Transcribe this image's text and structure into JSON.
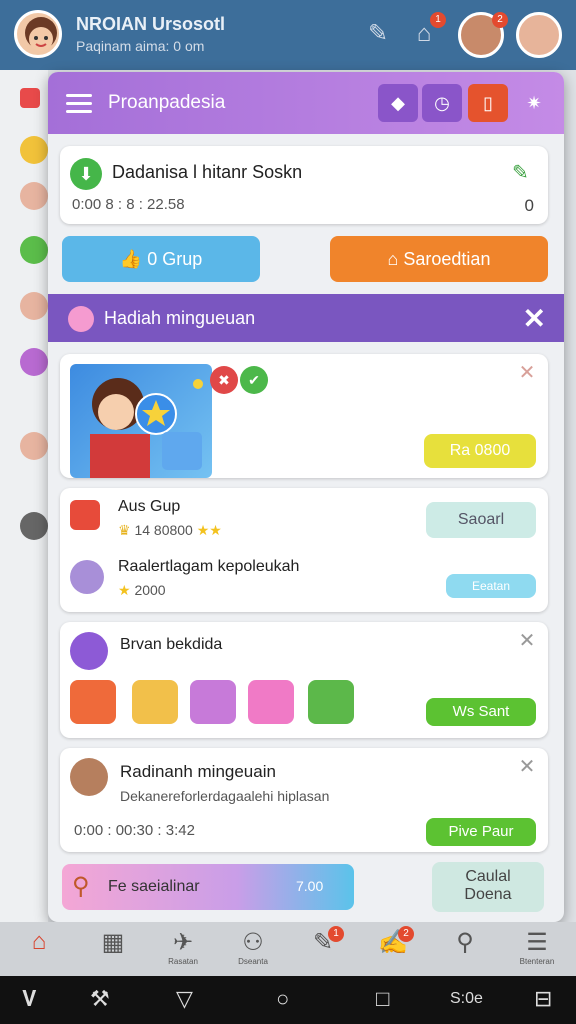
{
  "app_header": {
    "title": "NROIAN Ursosotl",
    "subtitle": "Paqinam aima: 0 om",
    "badges": [
      "1",
      "2"
    ]
  },
  "modal": {
    "title": "Proanpadesia",
    "download_card": {
      "title": "Dadanisa l hitanr Soskn",
      "meta": "0:00 8 : 8 : 22.58",
      "count": "0"
    },
    "buttons": {
      "group": "0 Grup",
      "store": "Saroedtian"
    },
    "section": {
      "title": "Hadiah mingueuan"
    },
    "reward_card": {
      "price": "Ra 0800"
    },
    "task_card": {
      "item1_title": "Aus Gup",
      "item1_meta": "14 80800",
      "item1_button": "Saoarl",
      "item2_title": "Raalertlagam kepoleukah",
      "item2_meta": "2000",
      "item2_button": "Eeatan"
    },
    "gift_card": {
      "title": "Brvan bekdida",
      "button": "Ws Sant"
    },
    "weekly_card": {
      "title": "Radinanh mingeuain",
      "desc": "Dekanereforlerdagaalehi hiplasan",
      "meta": "0:00  : 00:30 : 3:42",
      "button": "Pive Paur"
    },
    "search": {
      "label": "Fe saeialinar",
      "value": "7.00"
    },
    "cancel": {
      "line1": "Caulal",
      "line2": "Doena"
    }
  },
  "bottom_nav": {
    "labels": [
      "",
      "",
      "Rasatan",
      "Dseanta",
      "",
      "",
      "",
      "Btenteran"
    ],
    "badges": [
      "1",
      "2"
    ]
  },
  "system_nav": {
    "time": "S:0e"
  },
  "colors": {
    "header_purple": "#a46fd8",
    "section_purple": "#7a56c0",
    "blue_button": "#5bb7e8",
    "orange_button": "#f0842b",
    "green_pill": "#5cc232",
    "yellow_pill": "#e7e03c"
  }
}
